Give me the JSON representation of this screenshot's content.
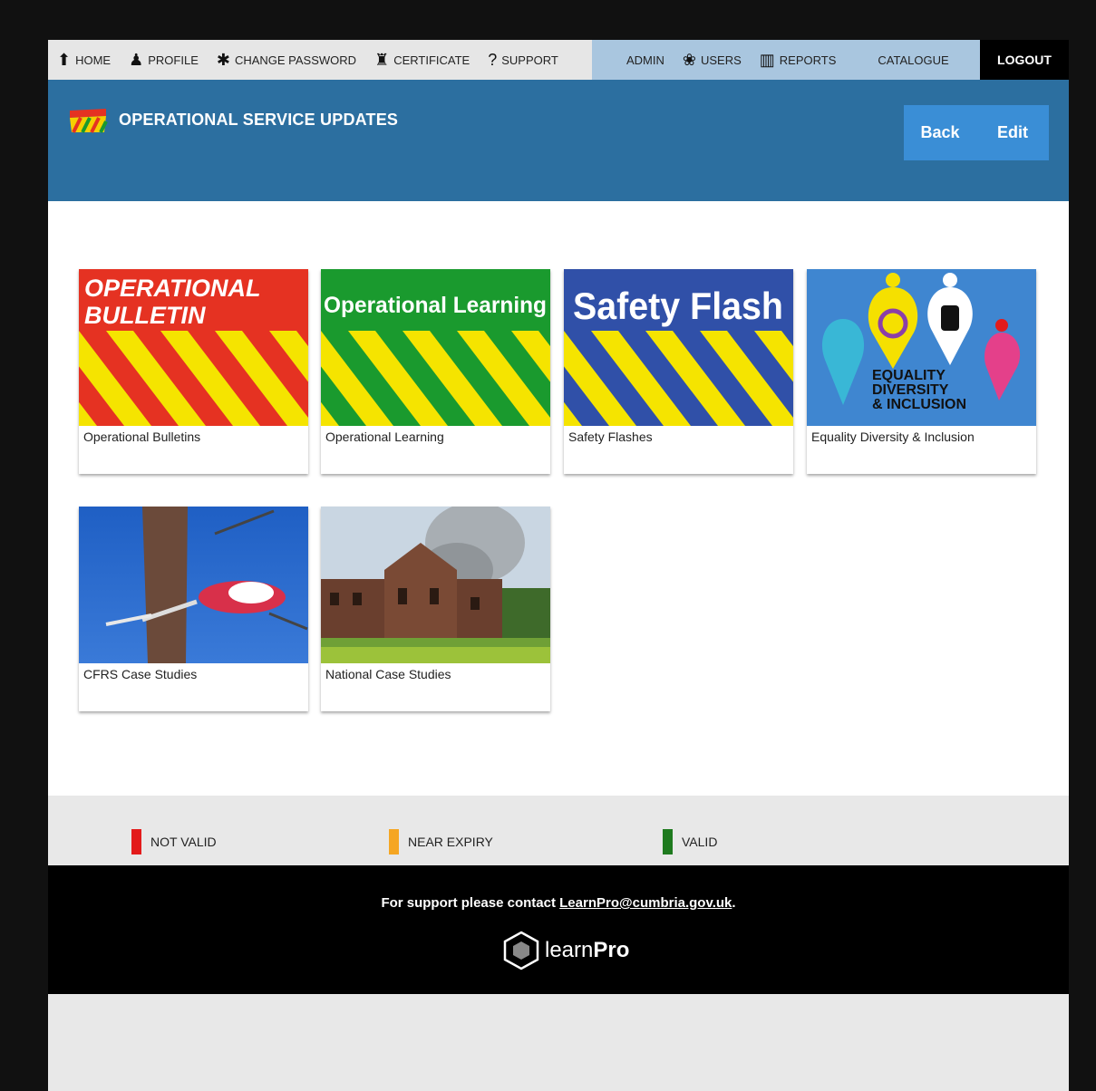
{
  "nav": {
    "items": [
      {
        "label": "HOME",
        "icon": "home-icon"
      },
      {
        "label": "PROFILE",
        "icon": "user-icon"
      },
      {
        "label": "CHANGE PASSWORD",
        "icon": "asterisk-icon"
      },
      {
        "label": "CERTIFICATE",
        "icon": "certificate-icon"
      },
      {
        "label": "SUPPORT",
        "icon": "question-icon"
      }
    ],
    "admin_items": [
      {
        "label": "ADMIN"
      },
      {
        "label": "USERS",
        "icon": "users-icon"
      },
      {
        "label": "REPORTS",
        "icon": "chart-icon"
      },
      {
        "label": "CATALOGUE"
      }
    ],
    "logout": "LOGOUT"
  },
  "header": {
    "title": "OPERATIONAL SERVICE UPDATES",
    "back": "Back",
    "edit": "Edit"
  },
  "cards": [
    {
      "label": "Operational Bulletins",
      "banner": "OPERATIONAL",
      "banner2": "BULLETIN"
    },
    {
      "label": "Operational Learning",
      "banner": "Operational Learning"
    },
    {
      "label": "Safety Flashes",
      "banner": "Safety Flash"
    },
    {
      "label": "Equality Diversity & Inclusion",
      "banner": "EQUALITY",
      "banner2": "DIVERSITY",
      "banner3": "& INCLUSION"
    },
    {
      "label": "CFRS Case Studies"
    },
    {
      "label": "National Case Studies"
    }
  ],
  "legend": [
    {
      "label": "NOT VALID",
      "color": "#e31b1b"
    },
    {
      "label": "NEAR EXPIRY",
      "color": "#f5a623"
    },
    {
      "label": "VALID",
      "color": "#1e7a1e"
    }
  ],
  "footer": {
    "support_text": "For support please contact ",
    "email": "LearnPro@cumbria.gov.uk",
    "period": ".",
    "brand_light": "learn",
    "brand_bold": "Pro"
  }
}
